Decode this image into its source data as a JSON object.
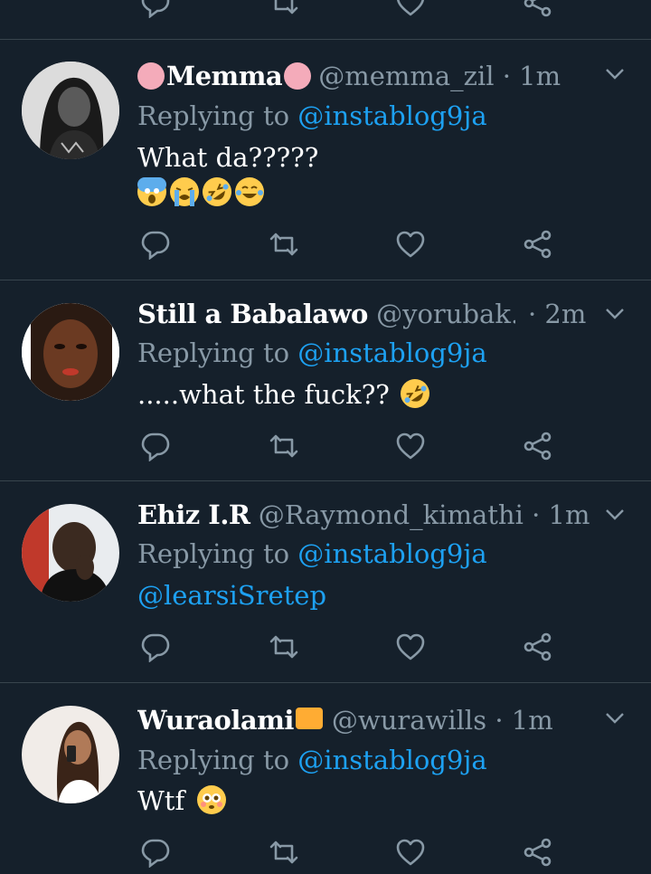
{
  "colors": {
    "background": "#15202b",
    "divider": "#38444d",
    "muted": "#8899a6",
    "link": "#1da1f2",
    "text": "#ffffff"
  },
  "icons": [
    "reply-icon",
    "retweet-icon",
    "like-icon",
    "share-icon",
    "chevron-down-icon"
  ],
  "tweets": [
    {
      "name": "Memma",
      "name_decoration": "flower-emoji",
      "handle": "@memma_zil",
      "time": "· 1m",
      "replying_prefix": "Replying to",
      "replying_to": "@instablog9ja",
      "text": "What da?????",
      "emojis": [
        "screaming-face-emoji",
        "loudly-crying-face-emoji",
        "rolling-on-floor-laughing-emoji",
        "tears-of-joy-emoji"
      ]
    },
    {
      "name": "Still a Babalawo",
      "handle": "@yorubak...",
      "time": "· 2m",
      "replying_prefix": "Replying to",
      "replying_to": "@instablog9ja",
      "text": ".....what the fuck??",
      "emojis": [
        "rolling-on-floor-laughing-emoji"
      ]
    },
    {
      "name": "Ehiz I.R",
      "handle": "@Raymond_kimathi",
      "time": "· 1m",
      "replying_prefix": "Replying to",
      "replying_to": "@instablog9ja",
      "text": "@learsiSretep"
    },
    {
      "name": "Wuraolami",
      "name_decoration": "crown-emoji",
      "handle": "@wurawills",
      "time": "· 1m",
      "replying_prefix": "Replying to",
      "replying_to": "@instablog9ja",
      "text": "Wtf",
      "emojis": [
        "flushed-face-emoji"
      ]
    }
  ]
}
